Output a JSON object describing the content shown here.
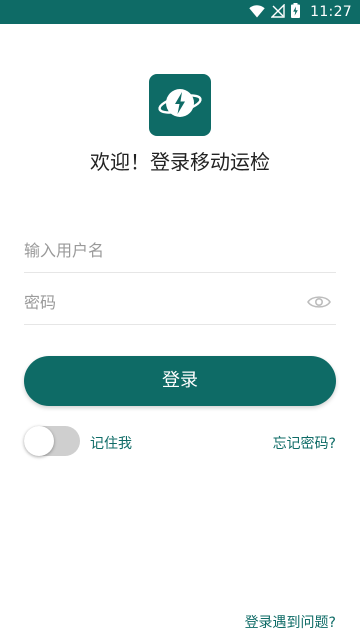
{
  "status_bar": {
    "time": "11:27",
    "icons": [
      "wifi-icon",
      "no-signal-icon",
      "battery-charging-icon"
    ]
  },
  "app": {
    "logo_icon": "lightning-globe-icon",
    "welcome_text": "欢迎！登录移动运检"
  },
  "form": {
    "username_placeholder": "输入用户名",
    "password_placeholder": "密码",
    "password_toggle_icon": "eye-icon",
    "login_label": "登录",
    "remember_label": "记住我",
    "remember_checked": false,
    "forgot_label": "忘记密码?"
  },
  "footer": {
    "problem_label": "登录遇到问题?"
  },
  "colors": {
    "primary": "#0e6b66",
    "status_bar": "#0e6b66",
    "toggle_off": "#cfcfcf"
  }
}
